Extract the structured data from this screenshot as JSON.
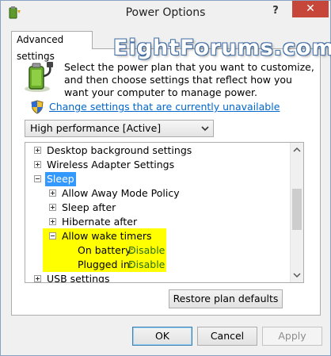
{
  "window": {
    "title": "Power Options"
  },
  "titlebar": {
    "help": "?",
    "close": "✕"
  },
  "tab": {
    "label": "Advanced settings"
  },
  "watermark": "EightForums.com",
  "intro": "Select the power plan that you want to customize, and then choose settings that reflect how you want your computer to manage power.",
  "change_link": "Change settings that are currently unavailable",
  "plan_select": {
    "selected": "High performance [Active]"
  },
  "tree": {
    "items": [
      {
        "label": "Desktop background settings",
        "state": "collapsed"
      },
      {
        "label": "Wireless Adapter Settings",
        "state": "collapsed"
      },
      {
        "label": "Sleep",
        "state": "expanded",
        "selected": true
      },
      {
        "label": "Allow Away Mode Policy",
        "state": "collapsed"
      },
      {
        "label": "Sleep after",
        "state": "collapsed"
      },
      {
        "label": "Hibernate after",
        "state": "collapsed"
      },
      {
        "label": "Allow wake timers",
        "state": "expanded"
      },
      {
        "label": "USB settings",
        "state": "collapsed"
      }
    ],
    "wake_timers": {
      "battery_label": "On battery:",
      "battery_value": "Disable",
      "plugged_label": "Plugged in:",
      "plugged_value": "Disable"
    }
  },
  "buttons": {
    "restore": "Restore plan defaults",
    "ok": "OK",
    "cancel": "Cancel",
    "apply": "Apply"
  },
  "colors": {
    "selection": "#3399ff",
    "highlight": "#ffff00",
    "link": "#0066cc",
    "close": "#c7463a",
    "value_green": "#2a6f13"
  }
}
